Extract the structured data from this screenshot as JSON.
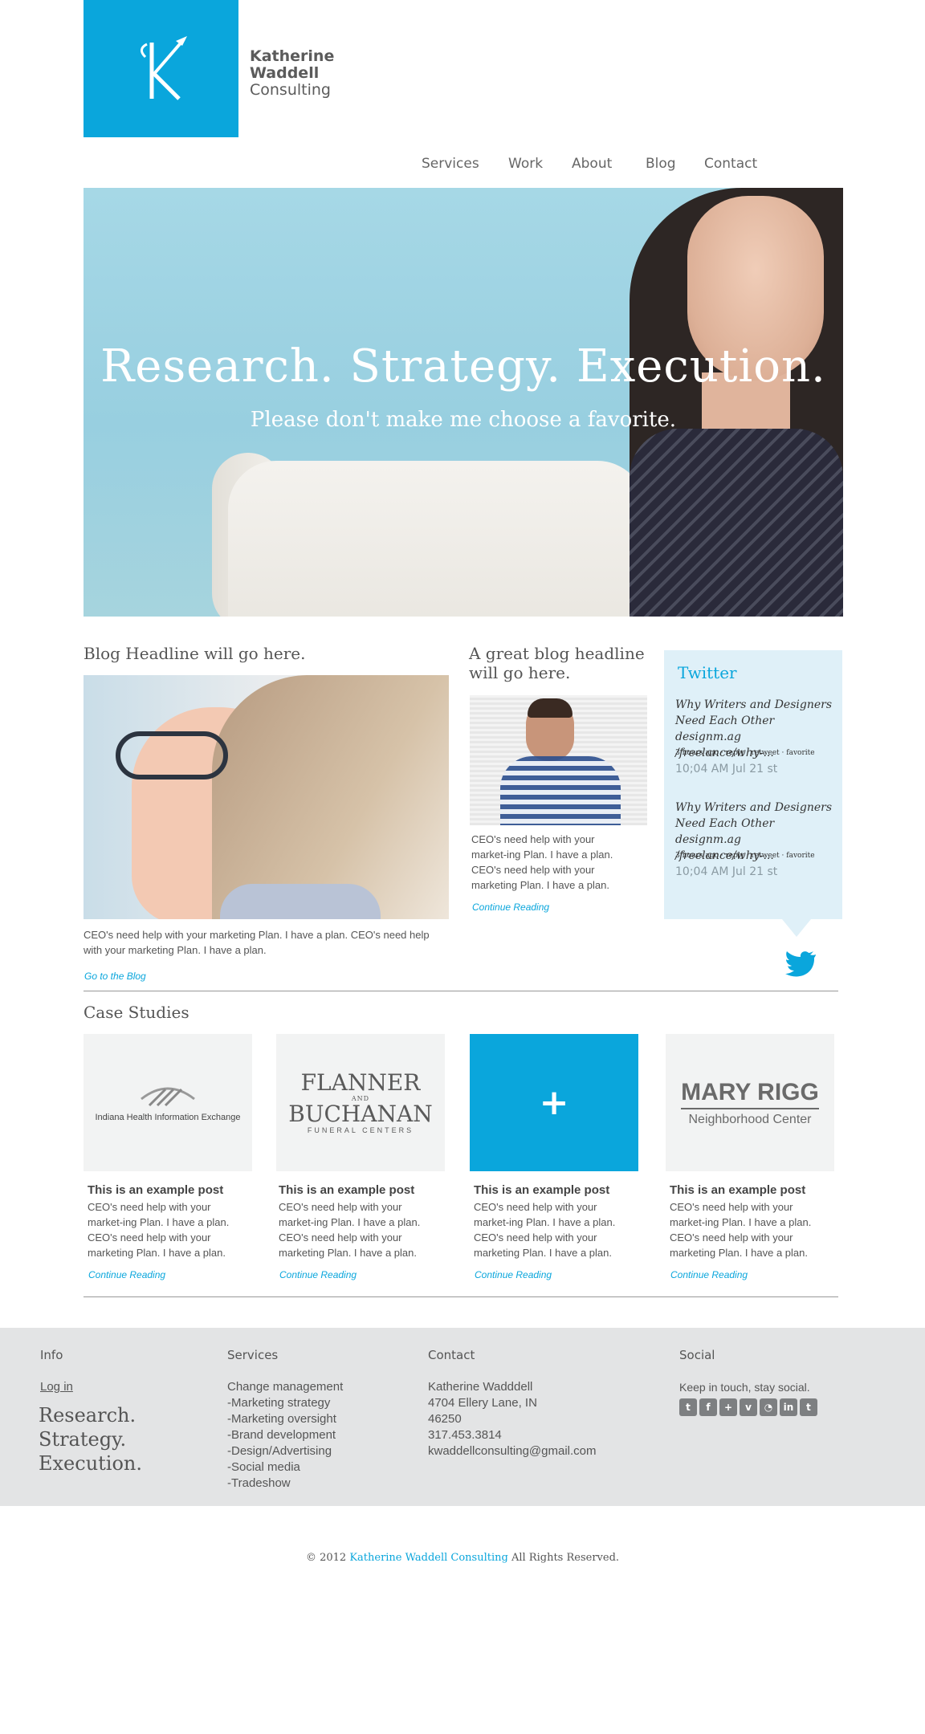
{
  "brand": {
    "line1": "Katherine",
    "line2": "Waddell",
    "line3": "Consulting",
    "accent_color": "#0aa6dc"
  },
  "nav": [
    {
      "label": "Services"
    },
    {
      "label": "Work"
    },
    {
      "label": "About"
    },
    {
      "label": "Blog"
    },
    {
      "label": "Contact"
    }
  ],
  "hero": {
    "headline": "Research. Strategy. Execution.",
    "subhead": "Please don't make me choose a favorite."
  },
  "blog": {
    "post1": {
      "headline": "Blog Headline will go here.",
      "excerpt": "CEO's need help with your marketing Plan. I have a plan.  CEO's need help with your marketing Plan. I have a plan.",
      "link": "Go to the Blog"
    },
    "post2": {
      "headline": "A great blog headline will go here.",
      "excerpt": "CEO's need help with your market-ing Plan. I have a plan.  CEO's need help with your marketing Plan. I have a plan.",
      "link": "Continue Reading"
    }
  },
  "twitter": {
    "title": "Twitter",
    "tweets": [
      {
        "text": "Why Writers and Designers Need Each Other designm.ag /freelance/why-...",
        "meta": "3 hours ago · reply · retweet · favorite",
        "time": "10;04 AM Jul 21 st"
      },
      {
        "text": "Why Writers and Designers Need Each Other designm.ag /freelance/why-...",
        "meta": "3 hours ago · reply · retweet · favorite",
        "time": "10;04 AM Jul 21 st"
      }
    ]
  },
  "case_studies": {
    "title": "Case Studies",
    "items": [
      {
        "logo": "Indiana Health Information Exchange",
        "title": "This is an example post",
        "excerpt": "CEO's need help with your market-ing Plan. I have a plan.  CEO's need help with your marketing Plan. I have a plan.",
        "link": "Continue Reading"
      },
      {
        "logo_line1": "FLANNER",
        "logo_and": "AND",
        "logo_line2": "BUCHANAN",
        "logo_line3": "FUNERAL CENTERS",
        "title": "This is an example post",
        "excerpt": "CEO's need help with your market-ing Plan. I have a plan.  CEO's need help with your marketing Plan. I have a plan.",
        "link": "Continue Reading"
      },
      {
        "logo": "+",
        "title": "This is an example post",
        "excerpt": "CEO's need help with your market-ing Plan. I have a plan.  CEO's need help with your marketing Plan. I have a plan.",
        "link": "Continue Reading"
      },
      {
        "logo_line1": "MARY RIGG",
        "logo_line2": "Neighborhood Center",
        "title": "This is an example post",
        "excerpt": "CEO's need help with your market-ing Plan. I have a plan.  CEO's need help with your marketing Plan. I have a plan.",
        "link": "Continue Reading"
      }
    ]
  },
  "footer": {
    "info": {
      "head": "Info",
      "login": "Log in",
      "tag1": "Research.",
      "tag2": "Strategy.",
      "tag3": "Execution."
    },
    "services": {
      "head": "Services",
      "items": [
        "Change management",
        "-Marketing strategy",
        "-Marketing oversight",
        "-Brand development",
        "-Design/Advertising",
        "-Social media",
        "-Tradeshow"
      ]
    },
    "contact": {
      "head": "Contact",
      "lines": [
        "Katherine Wadddell",
        "4704 Ellery Lane, IN",
        "46250",
        "317.453.3814",
        "kwaddellconsulting@gmail.com"
      ]
    },
    "social": {
      "head": "Social",
      "text": "Keep in touch, stay social.",
      "icons": [
        "twitter-icon",
        "facebook-icon",
        "google-plus-icon",
        "vimeo-icon",
        "rss-icon",
        "linkedin-icon",
        "tumblr-icon"
      ]
    }
  },
  "copyright": {
    "prefix": "© 2012",
    "name": "Katherine Waddell Consulting",
    "suffix": "All Rights Reserved."
  }
}
